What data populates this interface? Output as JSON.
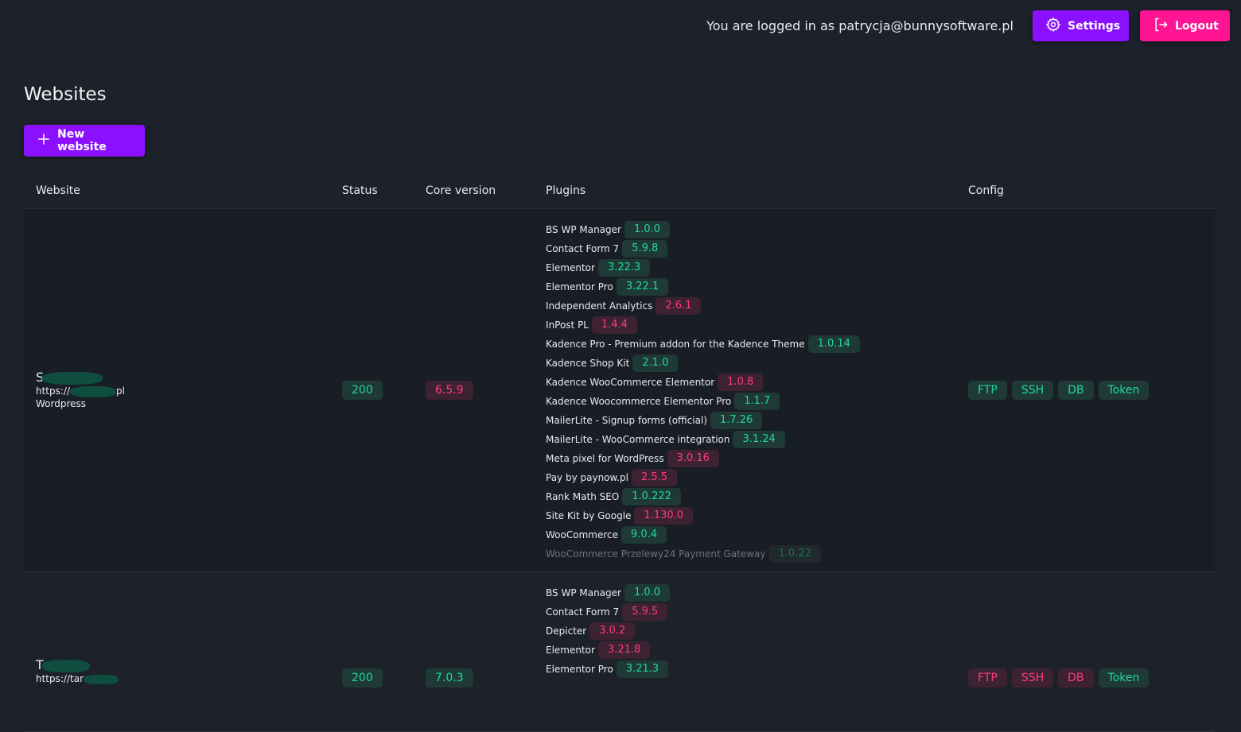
{
  "header": {
    "logged_in_text": "You are logged in as patrycja@bunnysoftware.pl",
    "settings_label": "Settings",
    "logout_label": "Logout"
  },
  "page": {
    "title": "Websites",
    "new_website_label": "New website"
  },
  "table": {
    "columns": [
      "Website",
      "Status",
      "Core version",
      "Plugins",
      "Config"
    ],
    "rows": [
      {
        "name": "S",
        "url_prefix": "https://",
        "url_suffix": "pl",
        "type": "Wordpress",
        "status": "200",
        "core_version": "6.5.9",
        "core_state": "bad",
        "plugins": [
          {
            "name": "BS WP Manager",
            "version": "1.0.0",
            "state": "ok"
          },
          {
            "name": "Contact Form 7",
            "version": "5.9.8",
            "state": "ok"
          },
          {
            "name": "Elementor",
            "version": "3.22.3",
            "state": "ok"
          },
          {
            "name": "Elementor Pro",
            "version": "3.22.1",
            "state": "ok"
          },
          {
            "name": "Independent Analytics",
            "version": "2.6.1",
            "state": "bad"
          },
          {
            "name": "InPost PL",
            "version": "1.4.4",
            "state": "bad"
          },
          {
            "name": "Kadence Pro - Premium addon for the Kadence Theme",
            "version": "1.0.14",
            "state": "ok"
          },
          {
            "name": "Kadence Shop Kit",
            "version": "2.1.0",
            "state": "ok"
          },
          {
            "name": "Kadence WooCommerce Elementor",
            "version": "1.0.8",
            "state": "bad"
          },
          {
            "name": "Kadence Woocommerce Elementor Pro",
            "version": "1.1.7",
            "state": "ok"
          },
          {
            "name": "MailerLite - Signup forms (official)",
            "version": "1.7.26",
            "state": "ok"
          },
          {
            "name": "MailerLite - WooCommerce integration",
            "version": "3.1.24",
            "state": "ok"
          },
          {
            "name": "Meta pixel for WordPress",
            "version": "3.0.16",
            "state": "bad"
          },
          {
            "name": "Pay by paynow.pl",
            "version": "2.5.5",
            "state": "bad"
          },
          {
            "name": "Rank Math SEO",
            "version": "1.0.222",
            "state": "ok"
          },
          {
            "name": "Site Kit by Google",
            "version": "1.130.0",
            "state": "bad"
          },
          {
            "name": "WooCommerce",
            "version": "9.0.4",
            "state": "ok"
          },
          {
            "name": "WooCommerce Przelewy24 Payment Gateway",
            "version": "1.0.22",
            "state": "muted"
          }
        ],
        "config": [
          {
            "label": "FTP",
            "state": "ok"
          },
          {
            "label": "SSH",
            "state": "ok"
          },
          {
            "label": "DB",
            "state": "ok"
          },
          {
            "label": "Token",
            "state": "ok"
          }
        ]
      },
      {
        "name": "T",
        "url_prefix": "https://tar",
        "status": "200",
        "core_version": "7.0.3",
        "core_state": "ok",
        "plugins": [
          {
            "name": "BS WP Manager",
            "version": "1.0.0",
            "state": "ok"
          },
          {
            "name": "Contact Form 7",
            "version": "5.9.5",
            "state": "bad"
          },
          {
            "name": "Depicter",
            "version": "3.0.2",
            "state": "bad"
          },
          {
            "name": "Elementor",
            "version": "3.21.8",
            "state": "bad"
          },
          {
            "name": "Elementor Pro",
            "version": "3.21.3",
            "state": "ok"
          }
        ],
        "config": [
          {
            "label": "FTP",
            "state": "bad"
          },
          {
            "label": "SSH",
            "state": "bad"
          },
          {
            "label": "DB",
            "state": "bad"
          },
          {
            "label": "Token",
            "state": "ok"
          }
        ]
      }
    ]
  },
  "icons": {
    "settings": "gear-icon",
    "logout": "logout-icon",
    "new": "plus-icon"
  },
  "colors": {
    "background": "#1d212a",
    "primary": "#8a10ff",
    "logout": "#ff1493",
    "ok_text": "#1fd99a",
    "bad_text": "#ff3c7a"
  }
}
